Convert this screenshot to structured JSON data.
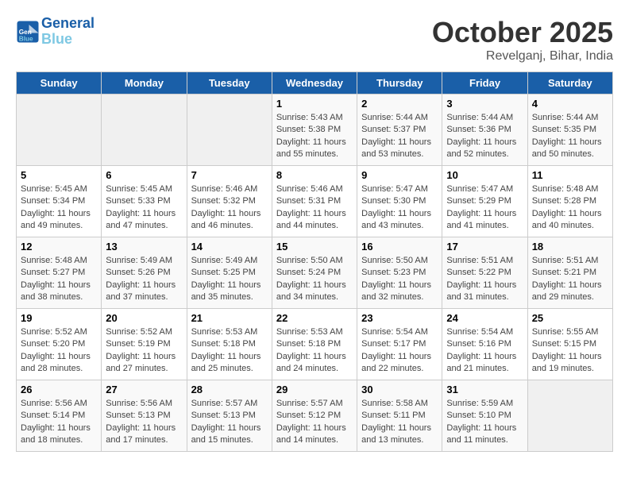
{
  "header": {
    "logo_line1": "General",
    "logo_line2": "Blue",
    "month": "October 2025",
    "location": "Revelganj, Bihar, India"
  },
  "days_of_week": [
    "Sunday",
    "Monday",
    "Tuesday",
    "Wednesday",
    "Thursday",
    "Friday",
    "Saturday"
  ],
  "weeks": [
    [
      {
        "day": "",
        "info": ""
      },
      {
        "day": "",
        "info": ""
      },
      {
        "day": "",
        "info": ""
      },
      {
        "day": "1",
        "info": "Sunrise: 5:43 AM\nSunset: 5:38 PM\nDaylight: 11 hours and 55 minutes."
      },
      {
        "day": "2",
        "info": "Sunrise: 5:44 AM\nSunset: 5:37 PM\nDaylight: 11 hours and 53 minutes."
      },
      {
        "day": "3",
        "info": "Sunrise: 5:44 AM\nSunset: 5:36 PM\nDaylight: 11 hours and 52 minutes."
      },
      {
        "day": "4",
        "info": "Sunrise: 5:44 AM\nSunset: 5:35 PM\nDaylight: 11 hours and 50 minutes."
      }
    ],
    [
      {
        "day": "5",
        "info": "Sunrise: 5:45 AM\nSunset: 5:34 PM\nDaylight: 11 hours and 49 minutes."
      },
      {
        "day": "6",
        "info": "Sunrise: 5:45 AM\nSunset: 5:33 PM\nDaylight: 11 hours and 47 minutes."
      },
      {
        "day": "7",
        "info": "Sunrise: 5:46 AM\nSunset: 5:32 PM\nDaylight: 11 hours and 46 minutes."
      },
      {
        "day": "8",
        "info": "Sunrise: 5:46 AM\nSunset: 5:31 PM\nDaylight: 11 hours and 44 minutes."
      },
      {
        "day": "9",
        "info": "Sunrise: 5:47 AM\nSunset: 5:30 PM\nDaylight: 11 hours and 43 minutes."
      },
      {
        "day": "10",
        "info": "Sunrise: 5:47 AM\nSunset: 5:29 PM\nDaylight: 11 hours and 41 minutes."
      },
      {
        "day": "11",
        "info": "Sunrise: 5:48 AM\nSunset: 5:28 PM\nDaylight: 11 hours and 40 minutes."
      }
    ],
    [
      {
        "day": "12",
        "info": "Sunrise: 5:48 AM\nSunset: 5:27 PM\nDaylight: 11 hours and 38 minutes."
      },
      {
        "day": "13",
        "info": "Sunrise: 5:49 AM\nSunset: 5:26 PM\nDaylight: 11 hours and 37 minutes."
      },
      {
        "day": "14",
        "info": "Sunrise: 5:49 AM\nSunset: 5:25 PM\nDaylight: 11 hours and 35 minutes."
      },
      {
        "day": "15",
        "info": "Sunrise: 5:50 AM\nSunset: 5:24 PM\nDaylight: 11 hours and 34 minutes."
      },
      {
        "day": "16",
        "info": "Sunrise: 5:50 AM\nSunset: 5:23 PM\nDaylight: 11 hours and 32 minutes."
      },
      {
        "day": "17",
        "info": "Sunrise: 5:51 AM\nSunset: 5:22 PM\nDaylight: 11 hours and 31 minutes."
      },
      {
        "day": "18",
        "info": "Sunrise: 5:51 AM\nSunset: 5:21 PM\nDaylight: 11 hours and 29 minutes."
      }
    ],
    [
      {
        "day": "19",
        "info": "Sunrise: 5:52 AM\nSunset: 5:20 PM\nDaylight: 11 hours and 28 minutes."
      },
      {
        "day": "20",
        "info": "Sunrise: 5:52 AM\nSunset: 5:19 PM\nDaylight: 11 hours and 27 minutes."
      },
      {
        "day": "21",
        "info": "Sunrise: 5:53 AM\nSunset: 5:18 PM\nDaylight: 11 hours and 25 minutes."
      },
      {
        "day": "22",
        "info": "Sunrise: 5:53 AM\nSunset: 5:18 PM\nDaylight: 11 hours and 24 minutes."
      },
      {
        "day": "23",
        "info": "Sunrise: 5:54 AM\nSunset: 5:17 PM\nDaylight: 11 hours and 22 minutes."
      },
      {
        "day": "24",
        "info": "Sunrise: 5:54 AM\nSunset: 5:16 PM\nDaylight: 11 hours and 21 minutes."
      },
      {
        "day": "25",
        "info": "Sunrise: 5:55 AM\nSunset: 5:15 PM\nDaylight: 11 hours and 19 minutes."
      }
    ],
    [
      {
        "day": "26",
        "info": "Sunrise: 5:56 AM\nSunset: 5:14 PM\nDaylight: 11 hours and 18 minutes."
      },
      {
        "day": "27",
        "info": "Sunrise: 5:56 AM\nSunset: 5:13 PM\nDaylight: 11 hours and 17 minutes."
      },
      {
        "day": "28",
        "info": "Sunrise: 5:57 AM\nSunset: 5:13 PM\nDaylight: 11 hours and 15 minutes."
      },
      {
        "day": "29",
        "info": "Sunrise: 5:57 AM\nSunset: 5:12 PM\nDaylight: 11 hours and 14 minutes."
      },
      {
        "day": "30",
        "info": "Sunrise: 5:58 AM\nSunset: 5:11 PM\nDaylight: 11 hours and 13 minutes."
      },
      {
        "day": "31",
        "info": "Sunrise: 5:59 AM\nSunset: 5:10 PM\nDaylight: 11 hours and 11 minutes."
      },
      {
        "day": "",
        "info": ""
      }
    ]
  ]
}
